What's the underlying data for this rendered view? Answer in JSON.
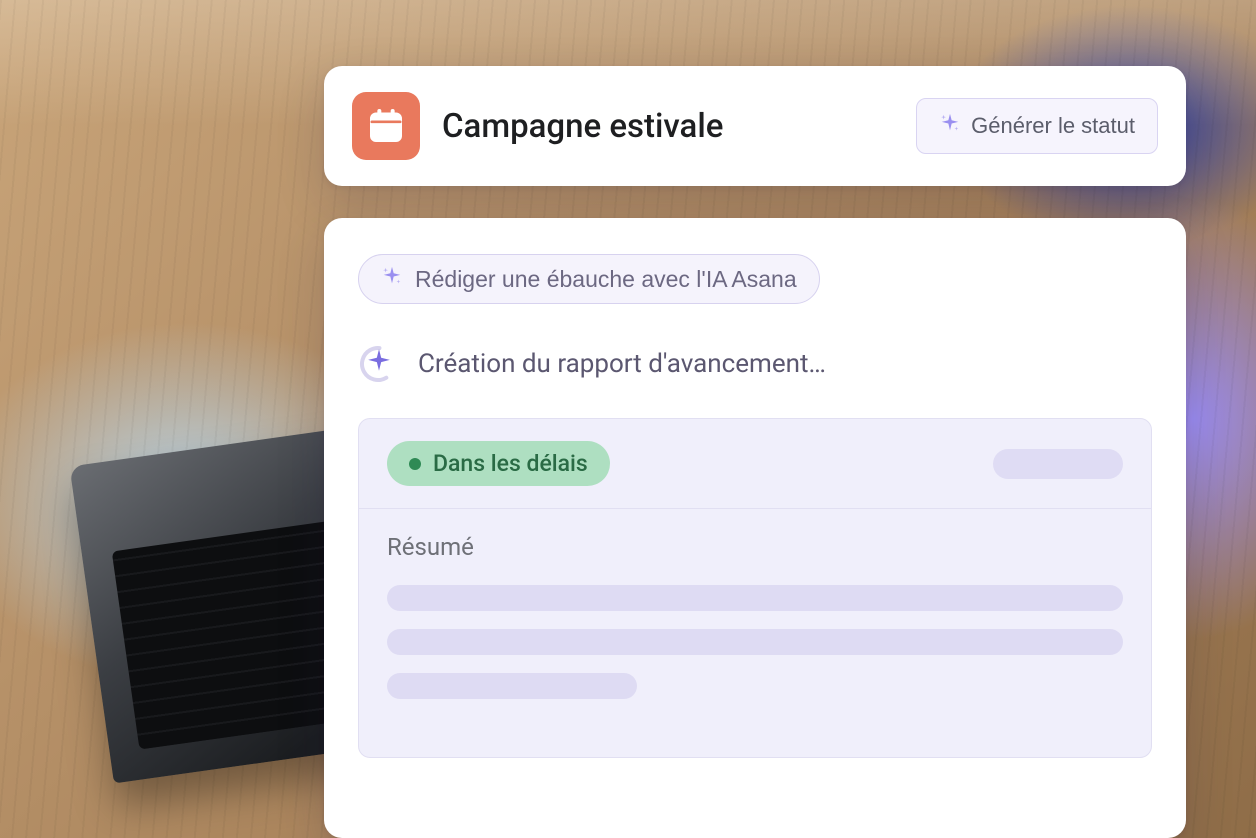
{
  "header": {
    "project_title": "Campagne estivale",
    "generate_button_label": "Générer le statut"
  },
  "body": {
    "ai_draft_button_label": "Rédiger une ébauche avec l'IA Asana",
    "progress_text": "Création du rapport d'avancement…"
  },
  "report": {
    "status_label": "Dans les délais",
    "summary_heading": "Résumé"
  },
  "icons": {
    "project": "calendar-icon",
    "sparkle": "sparkle-icon",
    "spinner": "spinner-icon"
  },
  "colors": {
    "project_icon_bg": "#e9795d",
    "ai_accent": "#8b7fe8",
    "status_bg": "#aedfc1",
    "status_text": "#2a6b45",
    "panel_bg": "#f0effb",
    "skeleton": "#dedbf3"
  }
}
